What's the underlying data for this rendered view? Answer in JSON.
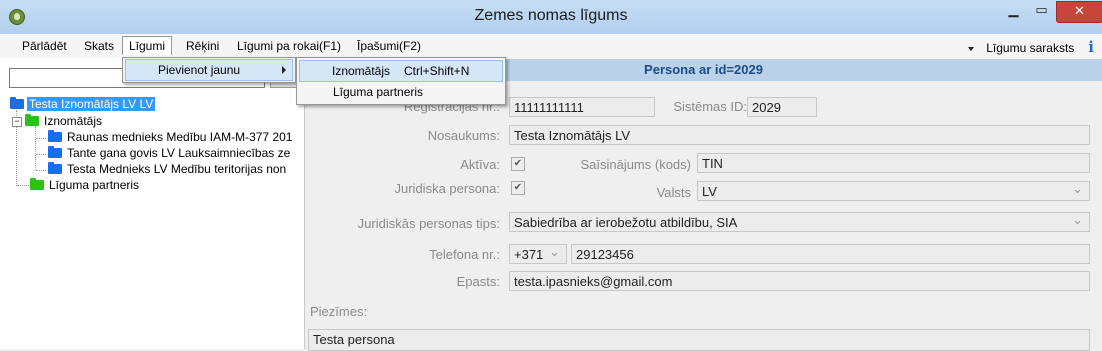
{
  "window": {
    "title": "Zemes nomas līgums"
  },
  "menubar": {
    "items": [
      "Pārlādēt",
      "Skats",
      "Līgumi",
      "Rēķini",
      "Līgumi pa rokai(F1)",
      "Īpašumi(F2)"
    ],
    "right_label": "Līgumu saraksts",
    "info": "i"
  },
  "menus": {
    "ligumi": {
      "item": "Pievienot jaunu"
    },
    "submenu": {
      "item1": "Iznomātājs",
      "shortcut1": "Ctrl+Shift+N",
      "item2": "Līguma partneris"
    }
  },
  "tree": {
    "root": "Testa Iznomātājs LV LV",
    "group1": "Iznomātājs",
    "children": [
      "Raunas mednieks Medību IAM-M-377 201",
      "Tante gana govis LV Lauksaimniecības ze",
      "Testa Mednieks LV Medību teritorijas non"
    ],
    "group2": "Līguma partneris"
  },
  "form": {
    "header": "Persona ar id=2029",
    "reg_label": "Reģistrācijas nr.:",
    "reg_value": "11111111111",
    "sysid_label": "Sistēmas ID:",
    "sysid_value": "2029",
    "name_label": "Nosaukums:",
    "name_value": "Testa Iznomātājs LV",
    "active_label": "Aktīva:",
    "abbr_label": "Saīsinājums (kods)",
    "abbr_value": "TIN",
    "legal_label": "Juridiska persona:",
    "country_label": "Valsts",
    "country_value": "LV",
    "type_label": "Juridiskās personas tips:",
    "type_value": "Sabiedrība ar ierobežotu atbildību, SIA",
    "phone_label": "Telefona nr.:",
    "phone_code": "+371",
    "phone_value": "29123456",
    "email_label": "Epasts:",
    "email_value": "testa.ipasnieks@gmail.com",
    "notes_label": "Piezīmes:",
    "notes_value": "Testa persona",
    "check": "✔"
  }
}
